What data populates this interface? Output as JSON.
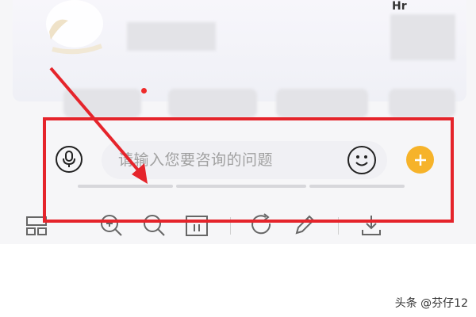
{
  "chat": {
    "input_placeholder": "请输入您要咨询的问题",
    "header_fragment": "Hr"
  },
  "icons": {
    "voice": "microphone-icon",
    "emoji": "smiley-icon",
    "more": "plus-icon",
    "toolbar": [
      "layout-icon",
      "zoom-in-icon",
      "zoom-out-icon",
      "fit-icon",
      "rotate-icon",
      "edit-pen-icon",
      "download-icon"
    ]
  },
  "colors": {
    "highlight": "#e5242b",
    "accent": "#f6b32a"
  },
  "watermark": "头条 @芬仔12"
}
